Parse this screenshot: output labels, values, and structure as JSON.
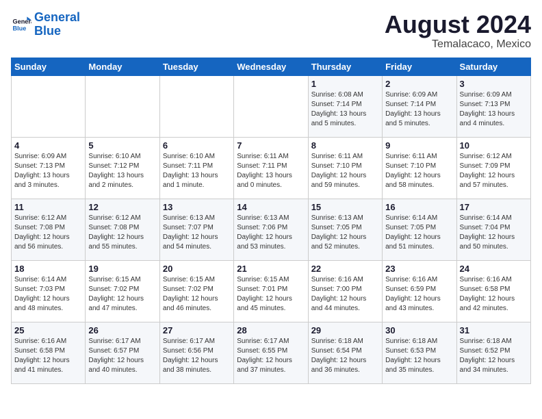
{
  "logo": {
    "line1": "General",
    "line2": "Blue"
  },
  "title": "August 2024",
  "location": "Temalacaco, Mexico",
  "days_of_week": [
    "Sunday",
    "Monday",
    "Tuesday",
    "Wednesday",
    "Thursday",
    "Friday",
    "Saturday"
  ],
  "weeks": [
    [
      {
        "day": "",
        "info": ""
      },
      {
        "day": "",
        "info": ""
      },
      {
        "day": "",
        "info": ""
      },
      {
        "day": "",
        "info": ""
      },
      {
        "day": "1",
        "info": "Sunrise: 6:08 AM\nSunset: 7:14 PM\nDaylight: 13 hours\nand 5 minutes."
      },
      {
        "day": "2",
        "info": "Sunrise: 6:09 AM\nSunset: 7:14 PM\nDaylight: 13 hours\nand 5 minutes."
      },
      {
        "day": "3",
        "info": "Sunrise: 6:09 AM\nSunset: 7:13 PM\nDaylight: 13 hours\nand 4 minutes."
      }
    ],
    [
      {
        "day": "4",
        "info": "Sunrise: 6:09 AM\nSunset: 7:13 PM\nDaylight: 13 hours\nand 3 minutes."
      },
      {
        "day": "5",
        "info": "Sunrise: 6:10 AM\nSunset: 7:12 PM\nDaylight: 13 hours\nand 2 minutes."
      },
      {
        "day": "6",
        "info": "Sunrise: 6:10 AM\nSunset: 7:11 PM\nDaylight: 13 hours\nand 1 minute."
      },
      {
        "day": "7",
        "info": "Sunrise: 6:11 AM\nSunset: 7:11 PM\nDaylight: 13 hours\nand 0 minutes."
      },
      {
        "day": "8",
        "info": "Sunrise: 6:11 AM\nSunset: 7:10 PM\nDaylight: 12 hours\nand 59 minutes."
      },
      {
        "day": "9",
        "info": "Sunrise: 6:11 AM\nSunset: 7:10 PM\nDaylight: 12 hours\nand 58 minutes."
      },
      {
        "day": "10",
        "info": "Sunrise: 6:12 AM\nSunset: 7:09 PM\nDaylight: 12 hours\nand 57 minutes."
      }
    ],
    [
      {
        "day": "11",
        "info": "Sunrise: 6:12 AM\nSunset: 7:08 PM\nDaylight: 12 hours\nand 56 minutes."
      },
      {
        "day": "12",
        "info": "Sunrise: 6:12 AM\nSunset: 7:08 PM\nDaylight: 12 hours\nand 55 minutes."
      },
      {
        "day": "13",
        "info": "Sunrise: 6:13 AM\nSunset: 7:07 PM\nDaylight: 12 hours\nand 54 minutes."
      },
      {
        "day": "14",
        "info": "Sunrise: 6:13 AM\nSunset: 7:06 PM\nDaylight: 12 hours\nand 53 minutes."
      },
      {
        "day": "15",
        "info": "Sunrise: 6:13 AM\nSunset: 7:05 PM\nDaylight: 12 hours\nand 52 minutes."
      },
      {
        "day": "16",
        "info": "Sunrise: 6:14 AM\nSunset: 7:05 PM\nDaylight: 12 hours\nand 51 minutes."
      },
      {
        "day": "17",
        "info": "Sunrise: 6:14 AM\nSunset: 7:04 PM\nDaylight: 12 hours\nand 50 minutes."
      }
    ],
    [
      {
        "day": "18",
        "info": "Sunrise: 6:14 AM\nSunset: 7:03 PM\nDaylight: 12 hours\nand 48 minutes."
      },
      {
        "day": "19",
        "info": "Sunrise: 6:15 AM\nSunset: 7:02 PM\nDaylight: 12 hours\nand 47 minutes."
      },
      {
        "day": "20",
        "info": "Sunrise: 6:15 AM\nSunset: 7:02 PM\nDaylight: 12 hours\nand 46 minutes."
      },
      {
        "day": "21",
        "info": "Sunrise: 6:15 AM\nSunset: 7:01 PM\nDaylight: 12 hours\nand 45 minutes."
      },
      {
        "day": "22",
        "info": "Sunrise: 6:16 AM\nSunset: 7:00 PM\nDaylight: 12 hours\nand 44 minutes."
      },
      {
        "day": "23",
        "info": "Sunrise: 6:16 AM\nSunset: 6:59 PM\nDaylight: 12 hours\nand 43 minutes."
      },
      {
        "day": "24",
        "info": "Sunrise: 6:16 AM\nSunset: 6:58 PM\nDaylight: 12 hours\nand 42 minutes."
      }
    ],
    [
      {
        "day": "25",
        "info": "Sunrise: 6:16 AM\nSunset: 6:58 PM\nDaylight: 12 hours\nand 41 minutes."
      },
      {
        "day": "26",
        "info": "Sunrise: 6:17 AM\nSunset: 6:57 PM\nDaylight: 12 hours\nand 40 minutes."
      },
      {
        "day": "27",
        "info": "Sunrise: 6:17 AM\nSunset: 6:56 PM\nDaylight: 12 hours\nand 38 minutes."
      },
      {
        "day": "28",
        "info": "Sunrise: 6:17 AM\nSunset: 6:55 PM\nDaylight: 12 hours\nand 37 minutes."
      },
      {
        "day": "29",
        "info": "Sunrise: 6:18 AM\nSunset: 6:54 PM\nDaylight: 12 hours\nand 36 minutes."
      },
      {
        "day": "30",
        "info": "Sunrise: 6:18 AM\nSunset: 6:53 PM\nDaylight: 12 hours\nand 35 minutes."
      },
      {
        "day": "31",
        "info": "Sunrise: 6:18 AM\nSunset: 6:52 PM\nDaylight: 12 hours\nand 34 minutes."
      }
    ]
  ]
}
